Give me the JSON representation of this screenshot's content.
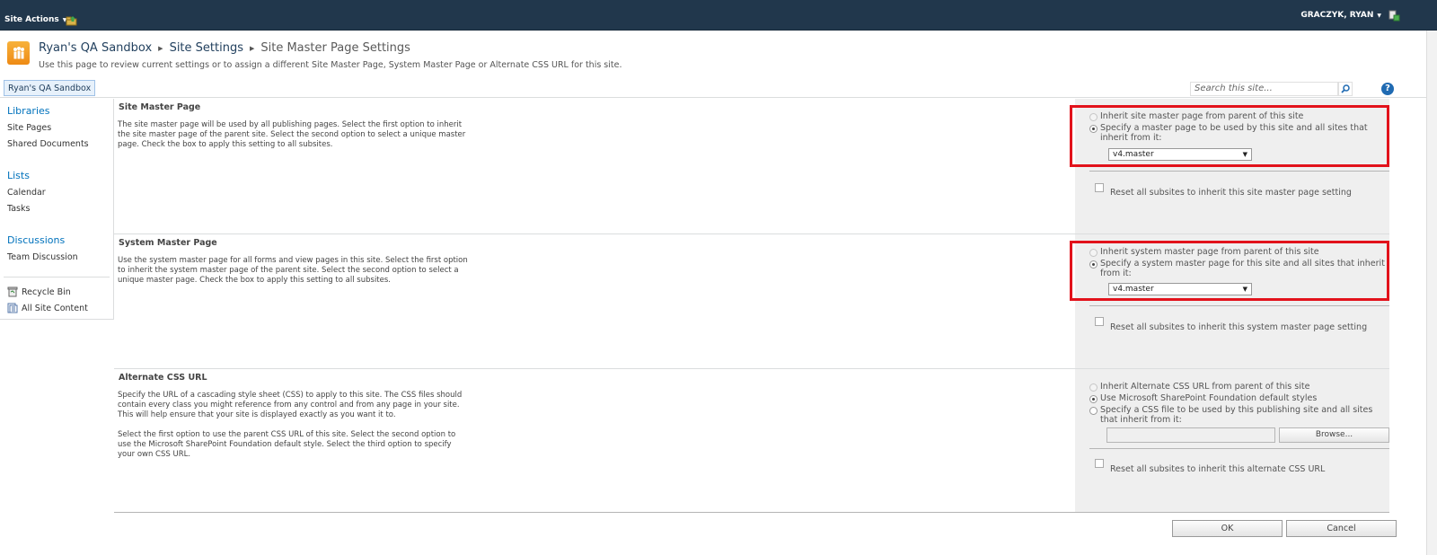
{
  "topbar": {
    "site_actions_label": "Site Actions",
    "user_name": "GRACZYK, RYAN"
  },
  "header": {
    "breadcrumb": [
      "Ryan's QA Sandbox",
      "Site Settings",
      "Site Master Page Settings"
    ],
    "description": "Use this page to review current settings or to assign a different Site Master Page, System Master Page or Alternate CSS URL for this site."
  },
  "toplinks": {
    "tab_label": "Ryan's QA Sandbox",
    "search_placeholder": "Search this site...",
    "help_label": "?"
  },
  "leftnav": {
    "libraries": {
      "heading": "Libraries",
      "items": [
        "Site Pages",
        "Shared Documents"
      ]
    },
    "lists": {
      "heading": "Lists",
      "items": [
        "Calendar",
        "Tasks"
      ]
    },
    "discussions": {
      "heading": "Discussions",
      "items": [
        "Team Discussion"
      ]
    },
    "utility": [
      "Recycle Bin",
      "All Site Content"
    ]
  },
  "site_master": {
    "title": "Site Master Page",
    "description": "The site master page will be used by all publishing pages. Select the first option to inherit the site master page of the parent site. Select the second option to select a unique master page. Check the box to apply this setting to all subsites.",
    "option_inherit": "Inherit site master page from parent of this site",
    "option_specify": "Specify a master page to be used by this site and all sites that inherit from it:",
    "selected_value": "v4.master",
    "reset_label": "Reset all subsites to inherit this site master page setting"
  },
  "system_master": {
    "title": "System Master Page",
    "description": "Use the system master page for all forms and view pages in this site. Select the first option to inherit the system master page of the parent site. Select the second option to select a unique master page. Check the box to apply this setting to all subsites.",
    "option_inherit": "Inherit system master page from parent of this site",
    "option_specify": "Specify a system master page for this site and all sites that inherit from it:",
    "selected_value": "v4.master",
    "reset_label": "Reset all subsites to inherit this system master page setting"
  },
  "alternate_css": {
    "title": "Alternate CSS URL",
    "description_1": "Specify the URL of a cascading style sheet (CSS) to apply to this site. The CSS files should contain every class you might reference from any control and from any page in your site. This will help ensure that your site is displayed exactly as you want it to.",
    "description_2": "Select the first option to use the parent CSS URL of this site. Select the second option to use the Microsoft SharePoint Foundation default style. Select the third option to specify your own CSS URL.",
    "option_inherit": "Inherit Alternate CSS URL from parent of this site",
    "option_default": "Use Microsoft SharePoint Foundation default styles",
    "option_specify": "Specify a CSS file to be used by this publishing site and all sites that inherit from it:",
    "css_url_value": "",
    "browse_label": "Browse...",
    "reset_label": "Reset all subsites to inherit this alternate CSS URL"
  },
  "footer": {
    "ok_label": "OK",
    "cancel_label": "Cancel"
  },
  "colors": {
    "topbar": "#21374c",
    "link_blue": "#0072bc",
    "highlight_red": "#e2121b",
    "option_panel": "#efefef"
  }
}
